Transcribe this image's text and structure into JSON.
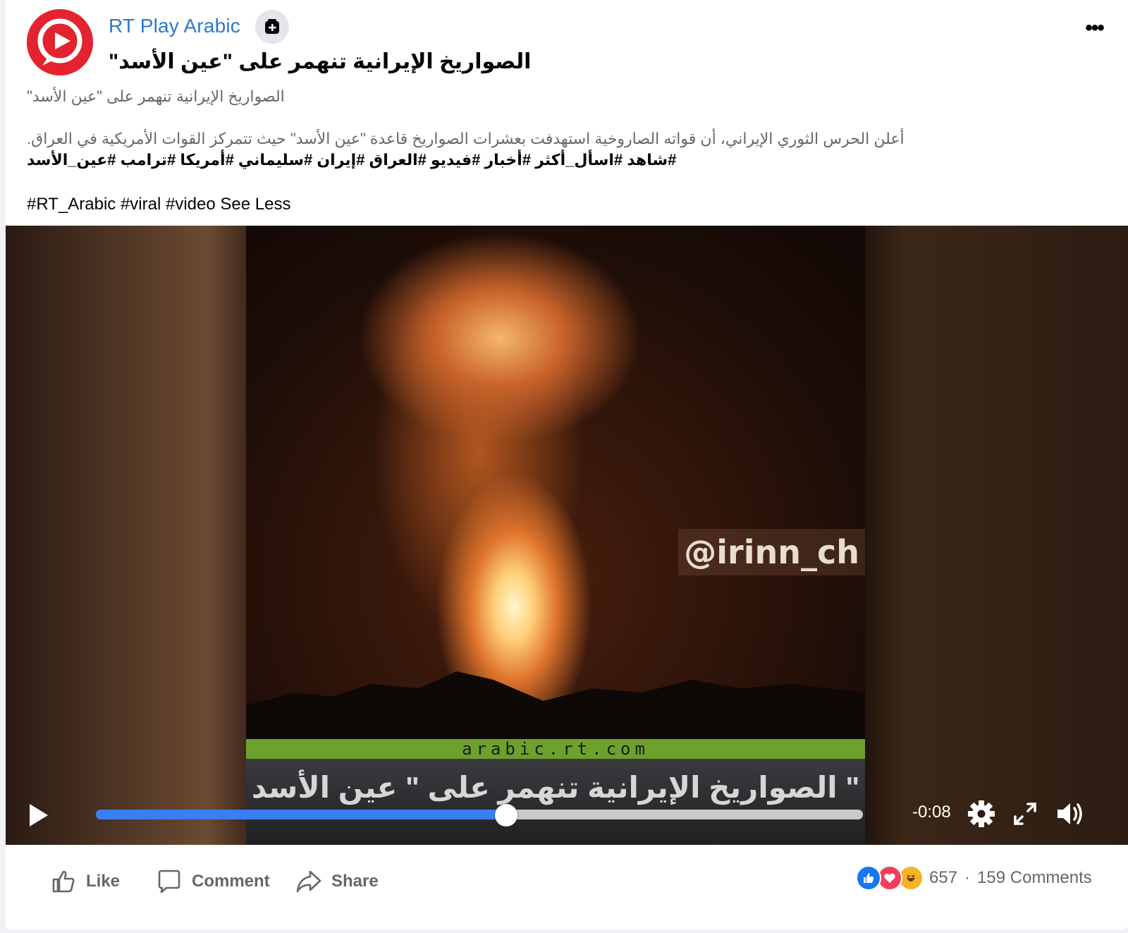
{
  "post": {
    "page_name": "RT Play Arabic",
    "title": "\"الصواريخ الإيرانية تنهمر على \"عين الأسد",
    "subtitle": "\"الصواريخ الإيرانية تنهمر على \"عين الأسد",
    "description": ".أعلن الحرس الثوري الإيراني، أن قواته الصاروخية استهدفت بعشرات الصواريخ قاعدة \"عين الأسد\" حيث تتمركز القوات الأمريكية في العراق",
    "hashtags_arabic": "شاهد #اسأل_أكثر #أخبار #فيديو #العراق #إيران #سليماني #أمريكا #ترامب #عين_الأسد#",
    "hashtags_english": "#RT_Arabic #viral #video",
    "see_less_label": "See Less",
    "avatar_icon": "rt-play-logo-icon",
    "follow_icon": "follow-page-icon",
    "more_icon": "more-options-icon",
    "more_label": "•••"
  },
  "video": {
    "watermark": "@irinn_ch",
    "site_url": "arabic.rt.com",
    "caption": "الصواريخ الإيرانية تنهمر على \" عين الأسد \"",
    "time_remaining": "-0:08",
    "progress": 0.535,
    "icons": [
      "play-icon",
      "settings-gear-icon",
      "fullscreen-icon",
      "volume-icon"
    ],
    "progress_color": "#3b7ef2",
    "banner_color": "#6ca22c"
  },
  "actions": {
    "like_label": "Like",
    "comment_label": "Comment",
    "share_label": "Share"
  },
  "reactions": {
    "types": [
      "like-reaction-icon",
      "love-reaction-icon",
      "haha-reaction-icon"
    ],
    "count": "657",
    "separator": "·",
    "comments_label": "159 Comments"
  },
  "colors": {
    "page_name": "#2d78c8",
    "brand_red": "#e3232f",
    "like_blue": "#1877f2",
    "love_red": "#f33e58",
    "haha_yellow": "#f7b125"
  }
}
